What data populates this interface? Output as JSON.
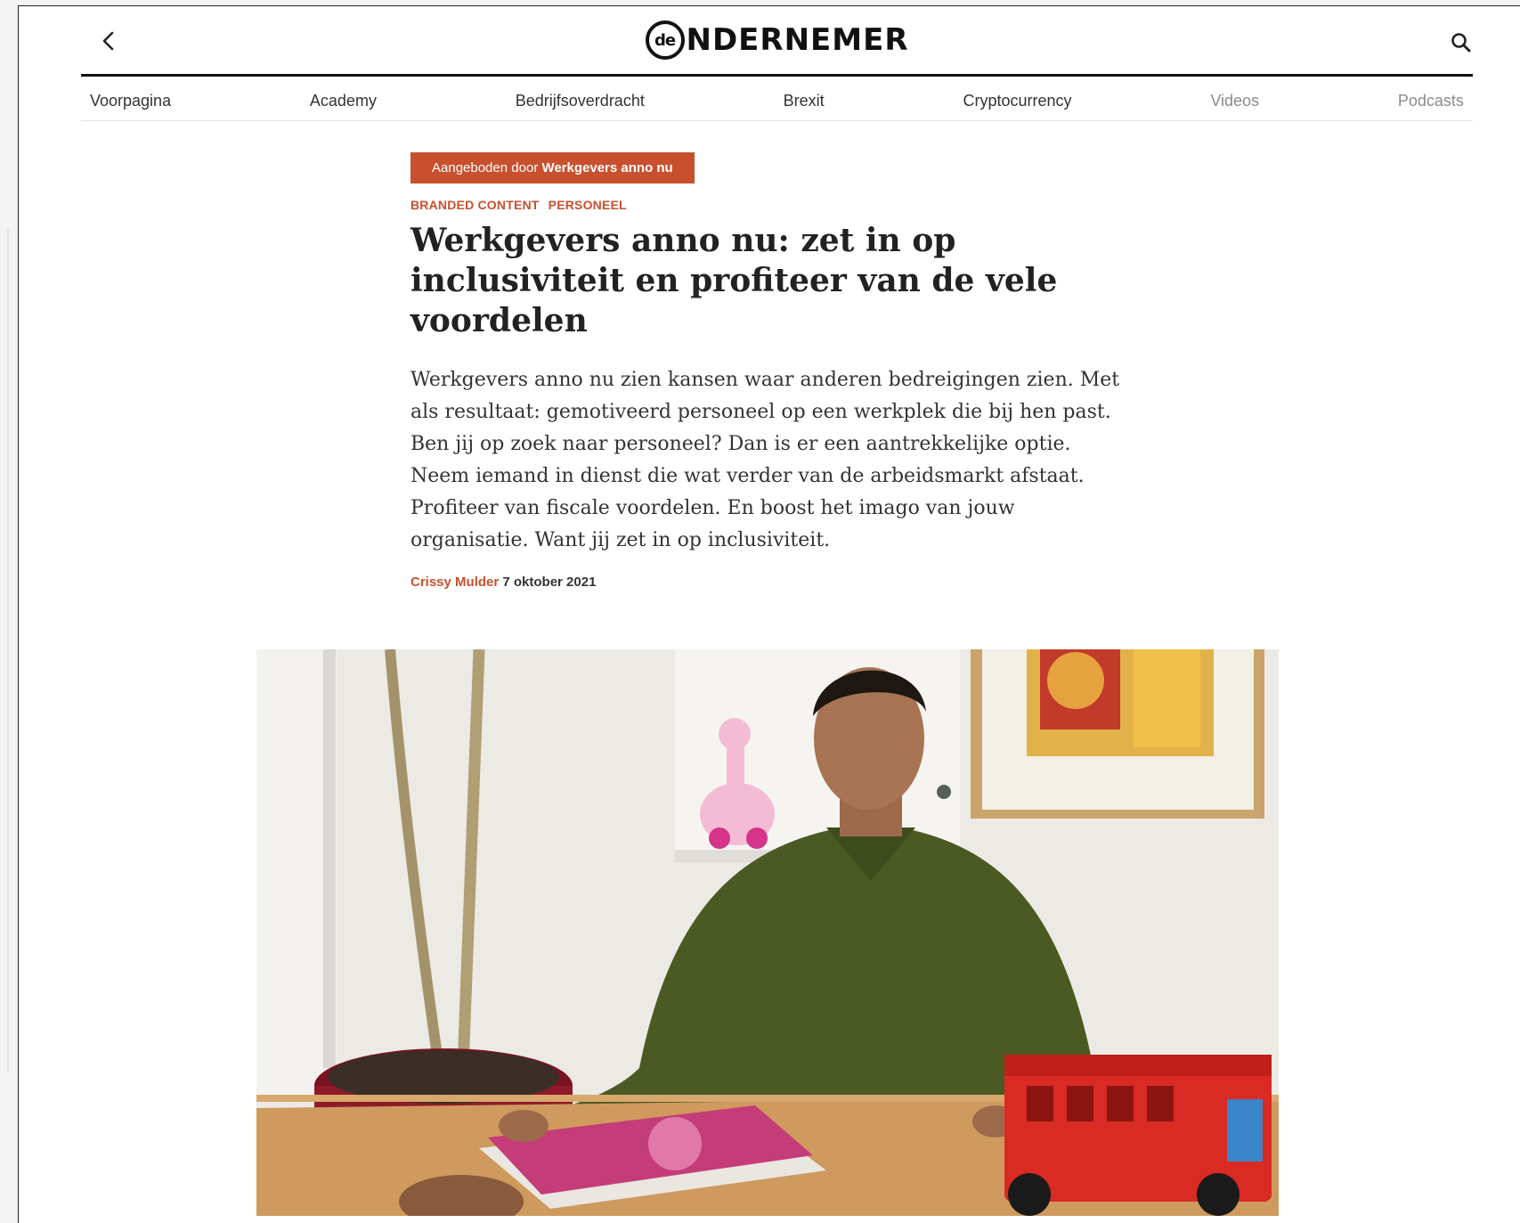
{
  "header": {
    "logo_badge": "de",
    "logo_text": "NDERNEMER"
  },
  "nav": {
    "items": [
      {
        "label": "Voorpagina"
      },
      {
        "label": "Academy"
      },
      {
        "label": "Bedrijfsoverdracht"
      },
      {
        "label": "Brexit"
      },
      {
        "label": "Cryptocurrency"
      },
      {
        "label": "Videos"
      },
      {
        "label": "Podcasts"
      }
    ]
  },
  "article": {
    "sponsor_prefix": "Aangeboden door",
    "sponsor_name": "Werkgevers anno nu",
    "categories": [
      "BRANDED CONTENT",
      "PERSONEEL"
    ],
    "title": "Werkgevers anno nu: zet in op inclusiviteit en profiteer van de vele voordelen",
    "lead": "Werkgevers anno nu zien kansen waar anderen bedreigingen zien. Met als resultaat: gemotiveerd personeel op een werkplek die bij hen past. Ben jij op zoek naar personeel? Dan is er een aantrekkelijke optie. Neem iemand in dienst die wat verder van de arbeidsmarkt afstaat. Profiteer van fiscale voordelen. En boost het imago van jouw organisatie. Want jij zet in op inclusiviteit.",
    "author": "Crissy Mulder",
    "date": "7 oktober 2021"
  },
  "icons": {
    "back": "chevron-left-icon",
    "search": "search-icon"
  },
  "colors": {
    "accent": "#c8502e",
    "text": "#222222"
  }
}
